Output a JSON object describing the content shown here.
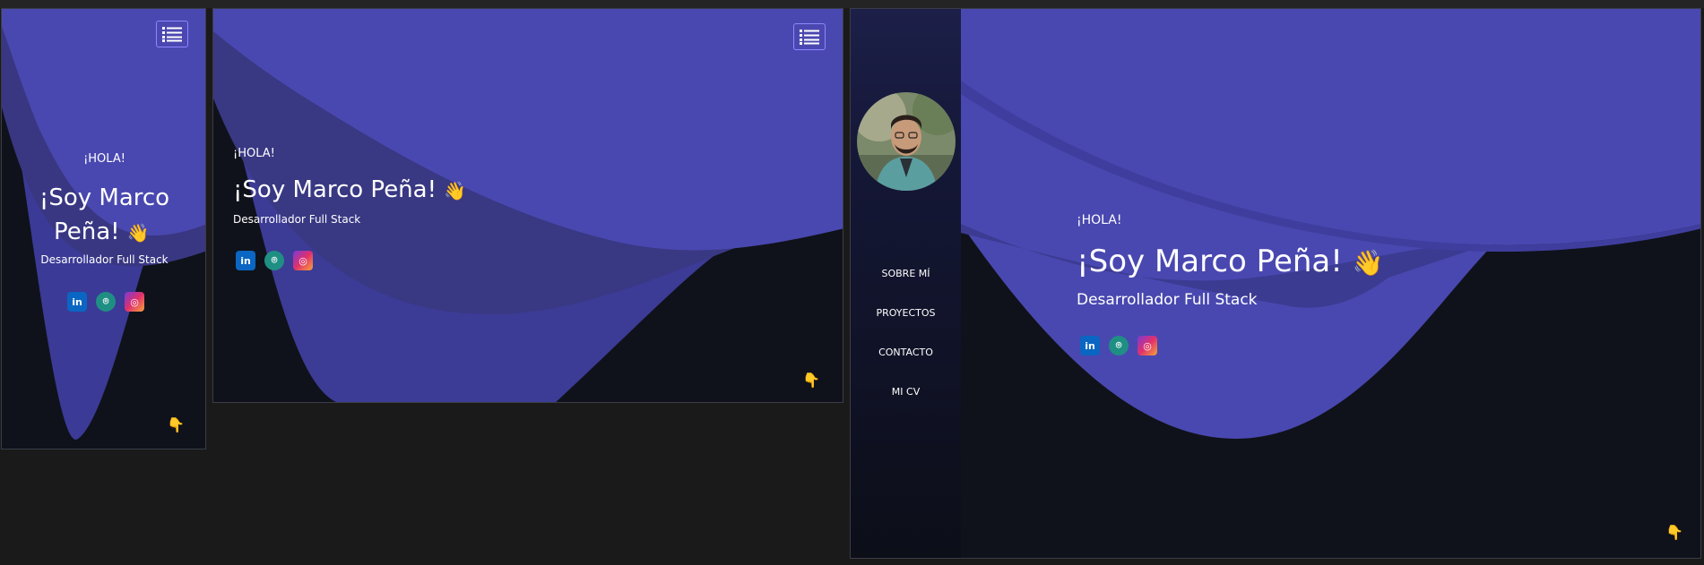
{
  "site": {
    "greeting": "¡HOLA!",
    "name": "¡Soy Marco Peña!",
    "name_line1": "¡Soy Marco",
    "name_line2": "Peña!",
    "wave_emoji": "👋",
    "role": "Desarrollador Full Stack",
    "pointer_emoji": "👇",
    "socials": [
      {
        "name": "LinkedIn",
        "glyph": "in",
        "icon": "linkedin-icon"
      },
      {
        "name": "GitHub",
        "glyph": "⌾",
        "icon": "github-icon"
      },
      {
        "name": "Instagram",
        "glyph": "◎",
        "icon": "instagram-icon"
      }
    ],
    "nav": {
      "items": [
        "SOBRE MÍ",
        "PROYECTOS",
        "CONTACTO",
        "MI CV"
      ]
    }
  },
  "colors": {
    "accent": "#4a48b0",
    "background": "#0f121a",
    "wave_mid": "#3a3a8f",
    "pointer": "#f2b23a"
  },
  "icons": {
    "menu": "hamburger-list-icon",
    "pointer": "hand-pointing-down-icon",
    "wave": "waving-hand-icon"
  }
}
